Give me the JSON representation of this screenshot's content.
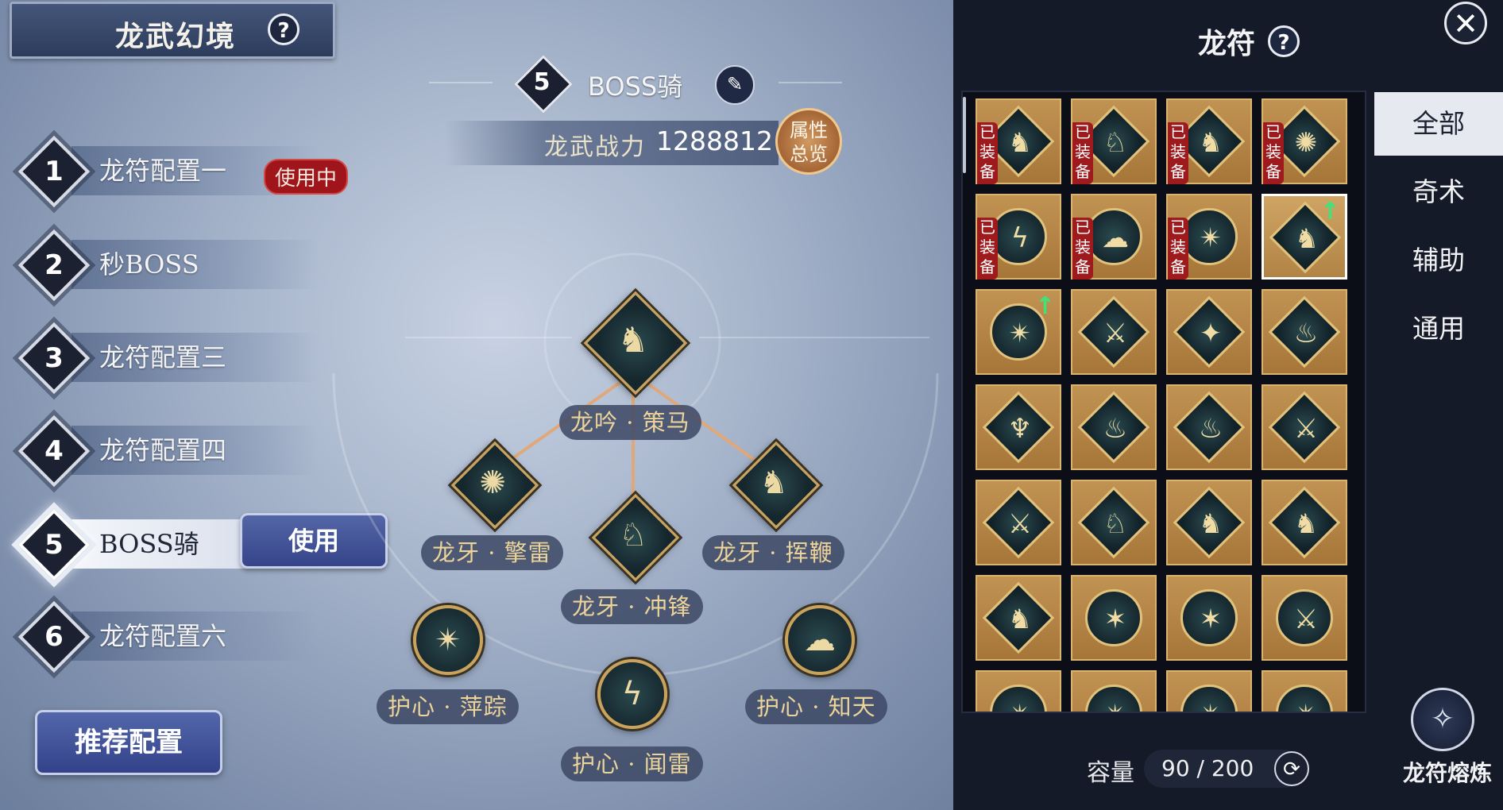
{
  "header": {
    "title": "龙武幻境",
    "help": "?"
  },
  "configs": [
    {
      "num": "1",
      "label": "龙符配置一",
      "badge": "使用中"
    },
    {
      "num": "2",
      "label": "秒BOSS"
    },
    {
      "num": "3",
      "label": "龙符配置三"
    },
    {
      "num": "4",
      "label": "龙符配置四"
    },
    {
      "num": "5",
      "label": "BOSS骑",
      "button": "使用",
      "active": true
    },
    {
      "num": "6",
      "label": "龙符配置六"
    }
  ],
  "recommend_label": "推荐配置",
  "preset": {
    "num": "5",
    "name": "BOSS骑",
    "edit_icon": "brush-icon"
  },
  "power": {
    "label": "龙武战力",
    "value": "1288812"
  },
  "attr_button": {
    "line1": "属性",
    "line2": "总览"
  },
  "tree": {
    "core": {
      "label": "龙吟 · 策马",
      "icon": "horseman-icon"
    },
    "fangs": [
      {
        "label": "龙牙 · 擎雷",
        "icon": "thunder-orb-icon"
      },
      {
        "label": "龙牙 · 冲锋",
        "icon": "charge-rider-icon"
      },
      {
        "label": "龙牙 · 挥鞭",
        "icon": "whip-rider-icon"
      }
    ],
    "hearts": [
      {
        "label": "护心 · 萍踪",
        "icon": "burst-icon"
      },
      {
        "label": "护心 · 闻雷",
        "icon": "lightning-icon"
      },
      {
        "label": "护心 · 知天",
        "icon": "cloud-icon"
      }
    ]
  },
  "rune_panel": {
    "title": "龙符",
    "help": "?",
    "close": "✕",
    "equipped_tag": "已装备",
    "tabs": [
      "全部",
      "奇术",
      "辅助",
      "通用"
    ],
    "active_tab": "全部",
    "capacity_label": "容量",
    "capacity_value": "90 / 200",
    "smelt_label": "龙符熔炼"
  }
}
